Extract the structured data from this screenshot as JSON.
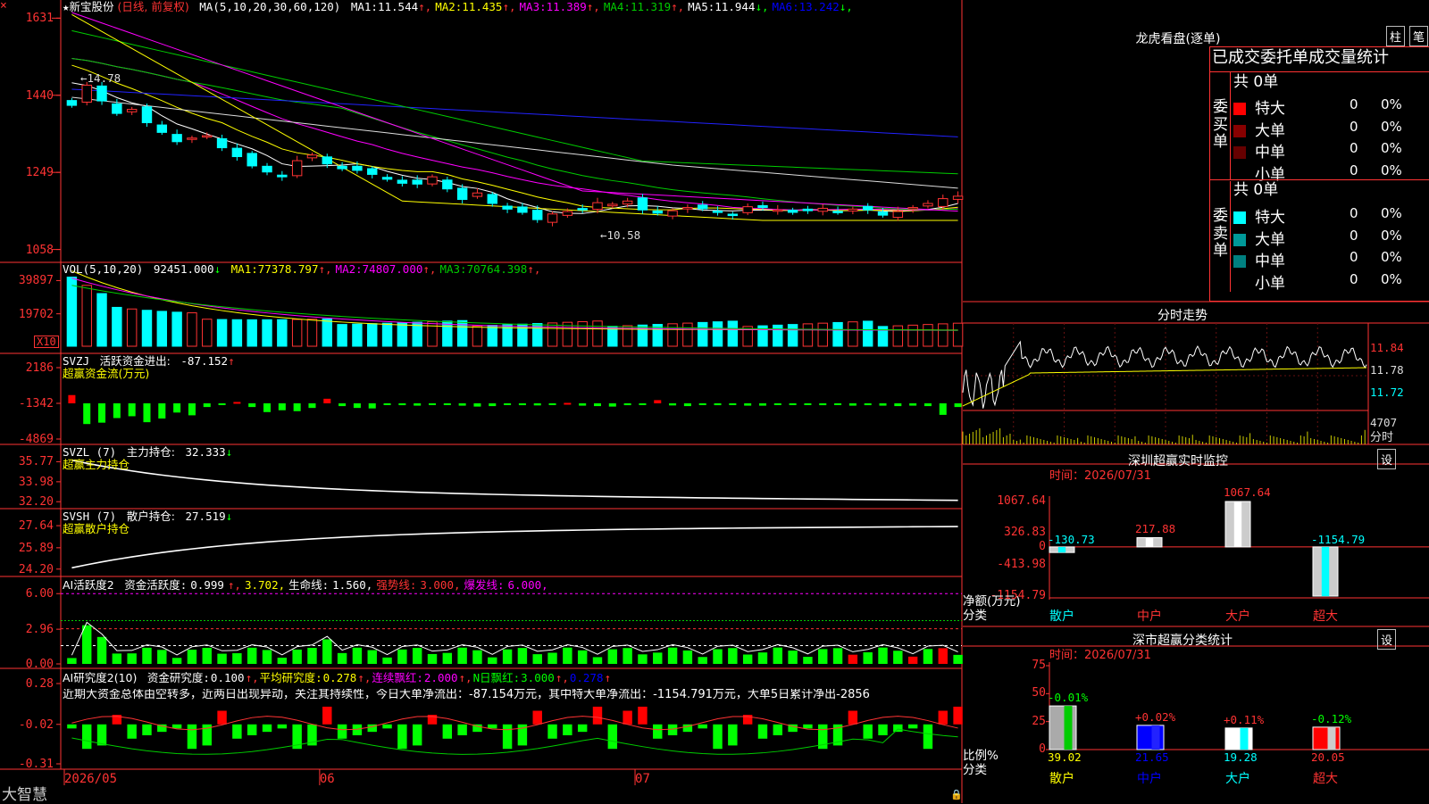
{
  "chart_data": [
    {
      "type": "candlestick",
      "name_label": "新宝股份",
      "mode_label": "(日线, 前复权)",
      "ma_label": "MA(5,10,20,30,60,120)",
      "ma_values": [
        {
          "name": "MA1",
          "value": "11.544",
          "arrow": "↑",
          "color": "#ffffff"
        },
        {
          "name": "MA2",
          "value": "11.435",
          "arrow": "↑",
          "color": "#ffff00"
        },
        {
          "name": "MA3",
          "value": "11.389",
          "arrow": "↑",
          "color": "#ff00ff"
        },
        {
          "name": "MA4",
          "value": "11.319",
          "arrow": "↑",
          "color": "#00cc00"
        },
        {
          "name": "MA5",
          "value": "11.944",
          "arrow": "↓",
          "color": "#ffffff"
        },
        {
          "name": "MA6",
          "value": "13.242",
          "arrow": "↓",
          "color": "#0000ff"
        }
      ],
      "y_ticks": [
        "1631",
        "1440",
        "1249",
        "1058"
      ],
      "high_marker": "←14.78",
      "low_marker": "←10.58",
      "close": [
        14.15,
        14.65,
        14.26,
        13.95,
        14.05,
        13.72,
        13.48,
        13.25,
        13.34,
        13.4,
        13.1,
        12.88,
        12.65,
        12.5,
        12.38,
        12.78,
        12.92,
        12.7,
        12.58,
        12.54,
        12.44,
        12.32,
        12.22,
        12.2,
        12.38,
        12.08,
        11.82,
        11.98,
        11.72,
        11.58,
        11.5,
        11.32,
        11.46,
        11.52,
        11.56,
        11.74,
        11.7,
        11.78,
        11.56,
        11.48,
        11.54,
        11.62,
        11.59,
        11.5,
        11.42,
        11.64,
        11.62,
        11.56,
        11.5,
        11.54,
        11.6,
        11.5,
        11.58,
        11.56,
        11.43,
        11.52,
        11.62,
        11.72,
        11.84,
        11.9
      ],
      "x_ticks": [
        {
          "label": "2026/05",
          "index": 0
        },
        {
          "label": "06",
          "index": 17
        },
        {
          "label": "07",
          "index": 38
        }
      ],
      "y_unit": "price (x0.01 on axis)"
    },
    {
      "type": "bar",
      "name": "VOL",
      "label": "VOL(5,10,20)",
      "value": "92451.000",
      "value_arrow": "↓",
      "ma": [
        {
          "name": "MA1",
          "value": "77378.797",
          "arrow": "↑",
          "color": "#ffff00"
        },
        {
          "name": "MA2",
          "value": "74807.000",
          "arrow": "↑",
          "color": "#ff00ff"
        },
        {
          "name": "MA3",
          "value": "70764.398",
          "arrow": "↑",
          "color": "#00cc00"
        }
      ],
      "y_ticks": [
        "39897",
        "19702"
      ],
      "unit_badge": "X10"
    },
    {
      "type": "bar",
      "label": "SVZJ",
      "title": "活跃资金进出:",
      "value": "-87.152",
      "value_arrow": "↑",
      "subtitle": "超赢资金流(万元)",
      "y_ticks": [
        "2186",
        "-1342",
        "-4869"
      ]
    },
    {
      "type": "line",
      "label": "SVZL (7)",
      "title": "主力持仓:",
      "value": "32.333",
      "value_arrow": "↓",
      "subtitle": "超赢主力持仓",
      "y_ticks": [
        "35.77",
        "33.98",
        "32.20"
      ]
    },
    {
      "type": "line",
      "label": "SVSH (7)",
      "title": "散户持仓:",
      "value": "27.519",
      "value_arrow": "↓",
      "subtitle": "超赢散户持仓",
      "y_ticks": [
        "27.64",
        "25.89",
        "24.20"
      ]
    },
    {
      "type": "bar",
      "label": "AI活跃度2",
      "items": [
        {
          "text": "资金活跃度:",
          "color": "#ffffff"
        },
        {
          "text": "0.999",
          "color": "#ffffff"
        },
        {
          "text": "↑,",
          "color": "#ff3333"
        },
        {
          "text": "3.702,",
          "color": "#ffff00"
        },
        {
          "text": "生命线:",
          "color": "#ffffff"
        },
        {
          "text": "1.560,",
          "color": "#ffffff"
        },
        {
          "text": "强势线:",
          "color": "#ff3333"
        },
        {
          "text": "3.000,",
          "color": "#ff3333"
        },
        {
          "text": "爆发线:",
          "color": "#ff00ff"
        },
        {
          "text": "6.000,",
          "color": "#ff00ff"
        }
      ],
      "y_ticks": [
        "6.00",
        "2.96",
        "0.00"
      ]
    },
    {
      "type": "bar",
      "label": "AI研究度2(10)",
      "items": [
        {
          "text": "资金研究度:",
          "color": "#ffffff"
        },
        {
          "text": "0.100",
          "color": "#ffffff"
        },
        {
          "text": "↑,",
          "color": "#ff3333"
        },
        {
          "text": "平均研究度:",
          "color": "#ffff00"
        },
        {
          "text": "0.278",
          "color": "#ffff00"
        },
        {
          "text": "↑,",
          "color": "#ff3333"
        },
        {
          "text": "连续飘红:",
          "color": "#ff00ff"
        },
        {
          "text": "2.000",
          "color": "#ff00ff"
        },
        {
          "text": "↑,",
          "color": "#ff3333"
        },
        {
          "text": "N日飘红:",
          "color": "#00ff00"
        },
        {
          "text": "3.000",
          "color": "#00ff00"
        },
        {
          "text": "↑,",
          "color": "#ff3333"
        },
        {
          "text": "0.278",
          "color": "#0000ff"
        },
        {
          "text": "↑",
          "color": "#ff3333"
        }
      ],
      "commentary": "近期大资金总体由空转多，近两日出现异动，关注其持续性，今日大单净流出：-87.154万元，其中特大单净流出：-1154.791万元，大单5日累计净出-2856",
      "y_ticks": [
        "0.28",
        "-0.02",
        "-0.31"
      ]
    }
  ],
  "app": {
    "brand": "大智慧",
    "close_glyph": "×"
  },
  "right_panel": {
    "lhb": {
      "title": "龙虎看盘(逐单)",
      "buttons": [
        "柱",
        "笔"
      ],
      "heading": "已成交委托单成交量统计",
      "buy": {
        "side_label": "委买单",
        "total": "共 0单",
        "rows": [
          {
            "label": "特大",
            "count": "0",
            "pct": "0%",
            "color": "#ff0000"
          },
          {
            "label": "大单",
            "count": "0",
            "pct": "0%",
            "color": "#880000"
          },
          {
            "label": "中单",
            "count": "0",
            "pct": "0%",
            "color": "#660000"
          },
          {
            "label": "小单",
            "count": "0",
            "pct": "0%",
            "color": "#000000"
          }
        ]
      },
      "sell": {
        "side_label": "委卖单",
        "total": "共 0单",
        "rows": [
          {
            "label": "特大",
            "count": "0",
            "pct": "0%",
            "color": "#00ffff"
          },
          {
            "label": "大单",
            "count": "0",
            "pct": "0%",
            "color": "#009999"
          },
          {
            "label": "中单",
            "count": "0",
            "pct": "0%",
            "color": "#008080"
          },
          {
            "label": "小单",
            "count": "0",
            "pct": "0%",
            "color": "#000000"
          }
        ]
      }
    },
    "intraday": {
      "title": "分时走势",
      "y_ticks": [
        "11.84",
        "11.78",
        "11.72"
      ],
      "vol_tick": "4707",
      "vol_label": "分时"
    },
    "monitor": {
      "title": "深圳超赢实时监控",
      "button": "设",
      "date": "时间：2026/07/31",
      "y_ticks": [
        "1067.64",
        "326.83",
        "0",
        "-413.98",
        "-1154.79"
      ],
      "axis_label": "净额(万元)",
      "cat_label": "分类",
      "categories": [
        "散户",
        "中户",
        "大户",
        "超大"
      ],
      "values": [
        -130.73,
        217.88,
        1067.64,
        -1154.79
      ],
      "value_labels": [
        "-130.73",
        "217.88",
        "1067.64",
        "-1154.79"
      ]
    },
    "classify": {
      "title": "深市超赢分类统计",
      "button": "设",
      "date": "时间：2026/07/31",
      "y_ticks": [
        "75",
        "50",
        "25",
        "0"
      ],
      "axis_label": "比例%",
      "cat_label": "分类",
      "categories": [
        "散户",
        "中户",
        "大户",
        "超大"
      ],
      "values": [
        39.02,
        21.65,
        19.28,
        20.05
      ],
      "value_labels": [
        "39.02",
        "21.65",
        "19.28",
        "20.05"
      ],
      "changes": [
        "-0.01%",
        "+0.02%",
        "+0.11%",
        "-0.12%"
      ]
    }
  }
}
